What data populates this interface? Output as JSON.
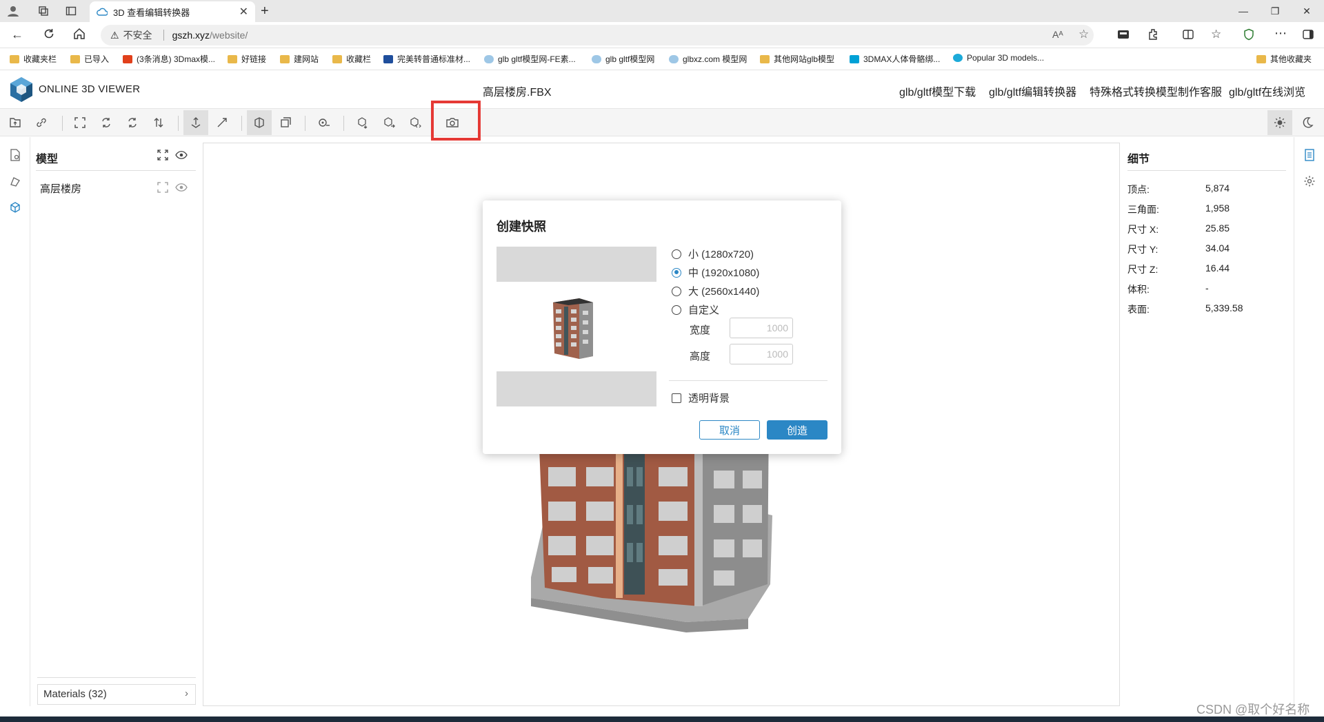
{
  "browser": {
    "tab_title": "3D 查看编辑转换器",
    "security_label": "不安全",
    "url_host": "gszh.xyz",
    "url_path": "/website/",
    "bookmarks": [
      {
        "label": "收藏夹栏",
        "icon": "folder-icon"
      },
      {
        "label": "已导入",
        "icon": "folder-icon"
      },
      {
        "label": "(3条消息) 3Dmax模...",
        "icon": "csdn-icon"
      },
      {
        "label": "好链接",
        "icon": "folder-icon"
      },
      {
        "label": "建网站",
        "icon": "folder-icon"
      },
      {
        "label": "收藏栏",
        "icon": "folder-icon"
      },
      {
        "label": "完美转普通标准材...",
        "icon": "site-icon"
      },
      {
        "label": "glb gltf模型网-FE素...",
        "icon": "cloud-icon"
      },
      {
        "label": "glb gltf模型网",
        "icon": "cloud-icon"
      },
      {
        "label": "glbxz.com 模型网",
        "icon": "cloud-icon"
      },
      {
        "label": "其他网站glb模型",
        "icon": "folder-icon"
      },
      {
        "label": "3DMAX人体骨骼绑...",
        "icon": "bilibili-icon"
      },
      {
        "label": "Popular 3D models...",
        "icon": "sketchfab-icon"
      }
    ],
    "other_favorites": "其他收藏夹"
  },
  "app": {
    "name": "ONLINE 3D VIEWER",
    "file_name": "高层楼房.FBX",
    "links": [
      "glb/gltf模型下载",
      "glb/gltf编辑转换器",
      "特殊格式转换模型制作客服",
      "glb/gltf在线浏览"
    ]
  },
  "model_panel": {
    "title": "模型",
    "item": "高层楼房",
    "materials": "Materials (32)"
  },
  "details": {
    "title": "细节",
    "rows": [
      {
        "key": "顶点:",
        "value": "5,874"
      },
      {
        "key": "三角面:",
        "value": "1,958"
      },
      {
        "key": "尺寸 X:",
        "value": "25.85"
      },
      {
        "key": "尺寸 Y:",
        "value": "34.04"
      },
      {
        "key": "尺寸 Z:",
        "value": "16.44"
      },
      {
        "key": "体积:",
        "value": "-"
      },
      {
        "key": "表面:",
        "value": "5,339.58"
      }
    ]
  },
  "snapshot_dialog": {
    "title": "创建快照",
    "options": [
      "小 (1280x720)",
      "中 (1920x1080)",
      "大 (2560x1440)",
      "自定义"
    ],
    "selected_option": "中 (1920x1080)",
    "width_label": "宽度",
    "width_placeholder": "1000",
    "height_label": "高度",
    "height_placeholder": "1000",
    "transparent_label": "透明背景",
    "transparent_checked": false,
    "cancel_label": "取消",
    "create_label": "创造"
  },
  "watermark": "CSDN @取个好名称",
  "colors": {
    "accent": "#2b87c5",
    "highlight": "#e53935"
  }
}
